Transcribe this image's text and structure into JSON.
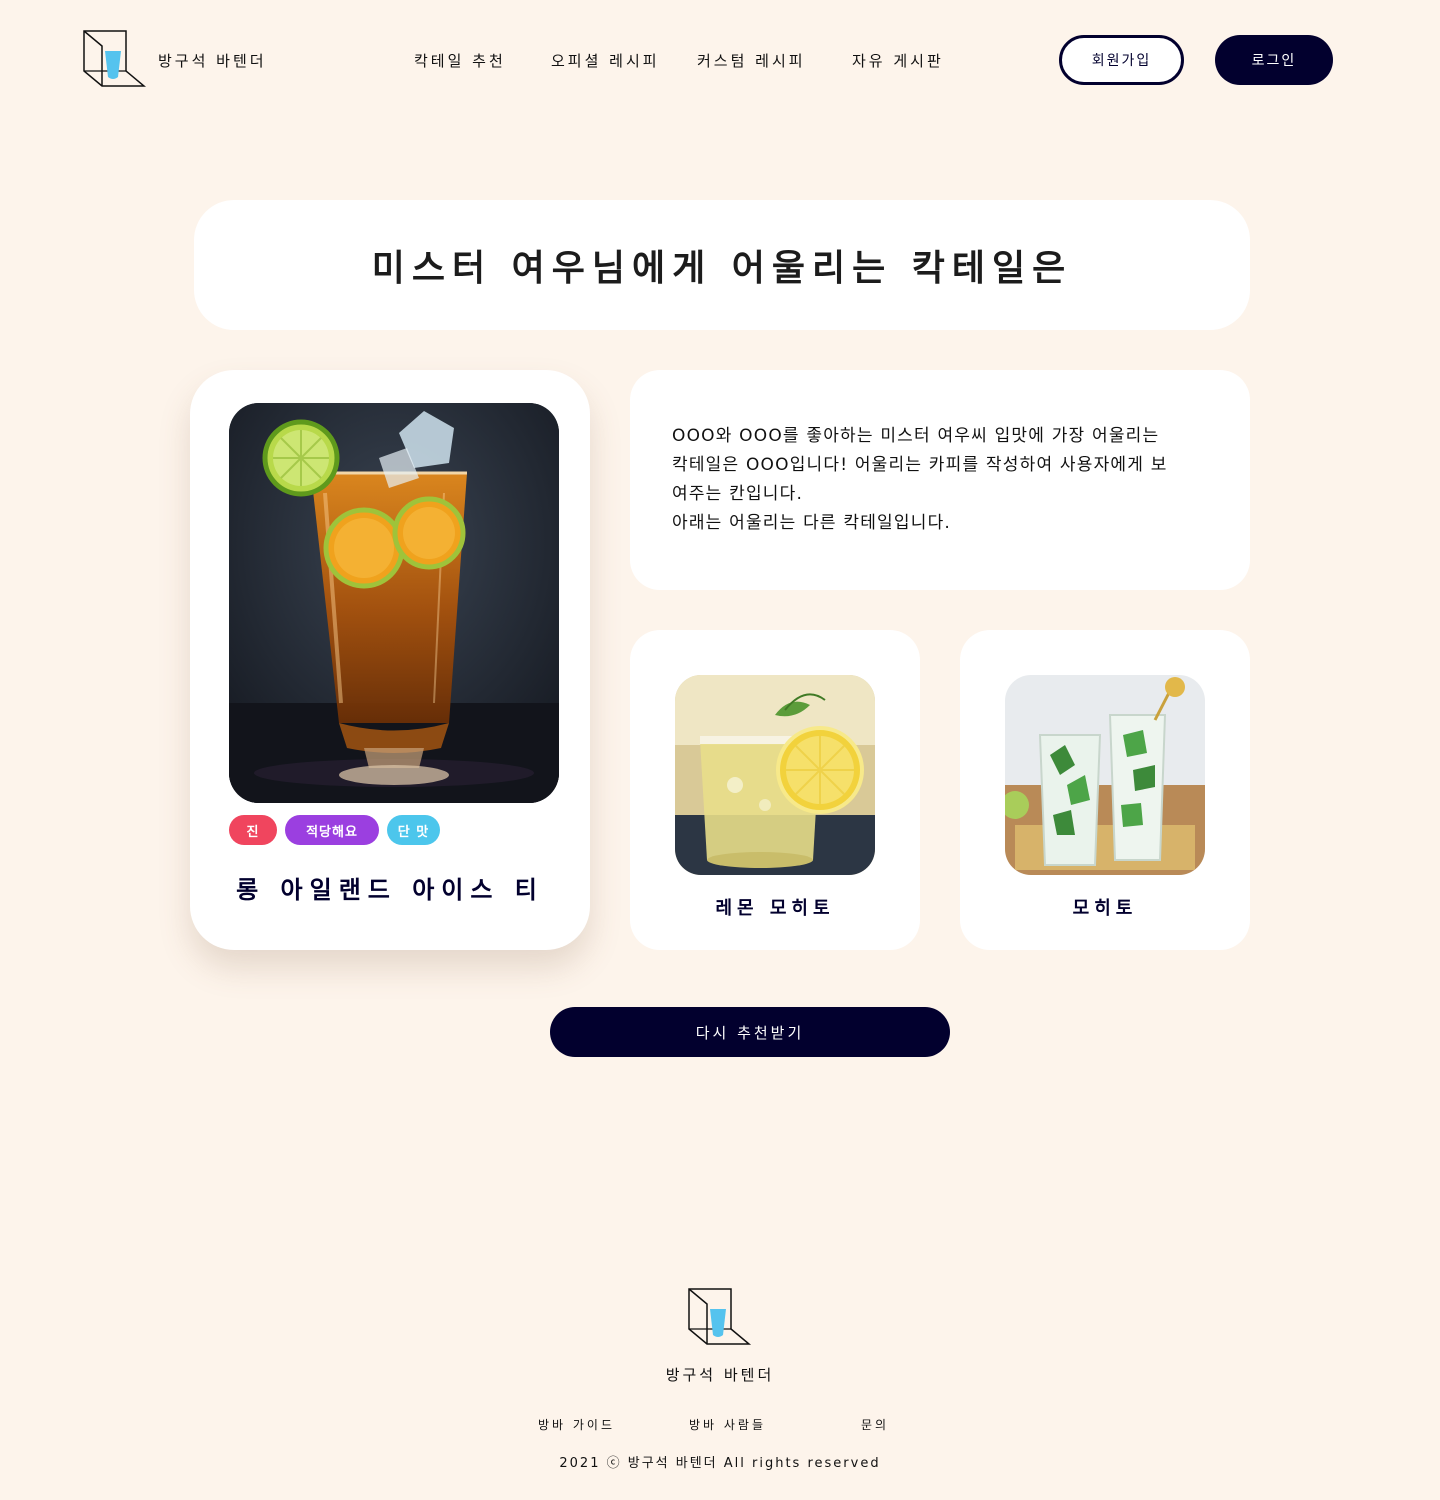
{
  "header": {
    "logo_text": "방구석 바텐더",
    "nav": [
      "칵테일 추천",
      "오피셜 레시피",
      "커스텀 레시피",
      "자유 게시판"
    ],
    "signup_label": "회원가입",
    "login_label": "로그인"
  },
  "headline": "미스터 여우님에게 어울리는 칵테일은",
  "main_cocktail": {
    "name": "롱 아일랜드 아이스 티",
    "tags": [
      {
        "label": "진",
        "color": "#f0455e"
      },
      {
        "label": "적당해요",
        "color": "#9b3fe0"
      },
      {
        "label": "단 맛",
        "color": "#4cc6ec"
      }
    ]
  },
  "description": {
    "lines": [
      "OOO와 OOO를 좋아하는 미스터 여우씨 입맛에 가장 어울리는",
      "칵테일은 OOO입니다! 어울리는 카피를 작성하여 사용자에게 보",
      "여주는 칸입니다.",
      "아래는 어울리는 다른 칵테일입니다."
    ]
  },
  "other_cocktails": [
    {
      "name": "레몬 모히토"
    },
    {
      "name": "모히토"
    }
  ],
  "retry_label": "다시 추천받기",
  "footer": {
    "logo_text": "방구석 바텐더",
    "links": [
      "방바 가이드",
      "방바 사람들",
      "문의"
    ],
    "copyright": "2021 ⓒ 방구석 바텐더 All rights reserved"
  },
  "colors": {
    "background": "#fdf4eb",
    "navy": "#02002e",
    "logo_cup": "#55c3ee"
  }
}
